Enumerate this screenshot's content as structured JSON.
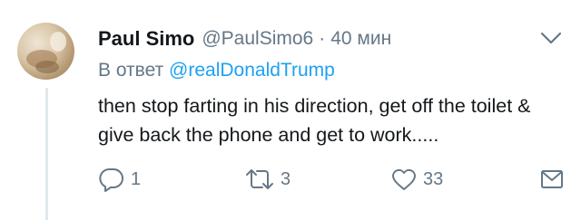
{
  "tweet": {
    "name": "Paul Simo",
    "handle": "@PaulSimo6",
    "separator": "·",
    "time": "40 мин",
    "reply_prefix": "В ответ",
    "reply_to": "@realDonaldTrump",
    "text": "then stop farting in his direction, get off the toilet & give back the phone and get to work....."
  },
  "actions": {
    "reply_count": "1",
    "retweet_count": "3",
    "like_count": "33"
  },
  "icons": {
    "menu": "chevron-down-icon",
    "reply": "reply-icon",
    "retweet": "retweet-icon",
    "like": "heart-icon",
    "message": "envelope-icon"
  },
  "colors": {
    "text": "#14171a",
    "secondary": "#657786",
    "link": "#1da1f2",
    "thread_line": "#e1e8ed"
  }
}
